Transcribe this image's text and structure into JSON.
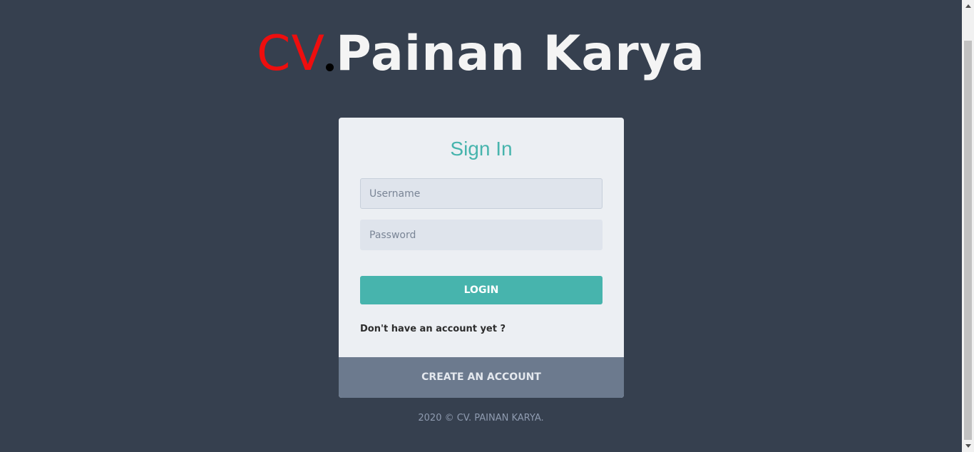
{
  "logo": {
    "prefix": "CV",
    "name": "Painan Karya"
  },
  "signin": {
    "title": "Sign In",
    "username_placeholder": "Username",
    "username_value": "",
    "password_placeholder": "Password",
    "password_value": "",
    "login_label": "LOGIN",
    "no_account_text": "Don't have an account yet ?",
    "create_account_label": "CREATE AN ACCOUNT"
  },
  "footer": {
    "text": "2020 © CV. PAINAN KARYA."
  },
  "colors": {
    "background": "#36404f",
    "accent": "#47b4ad",
    "logo_red": "#ee0e0e",
    "card": "#eceff3",
    "create_button": "#6c7a8e"
  },
  "icons": {
    "scroll_up": "triangle-up",
    "scroll_down": "triangle-down"
  }
}
